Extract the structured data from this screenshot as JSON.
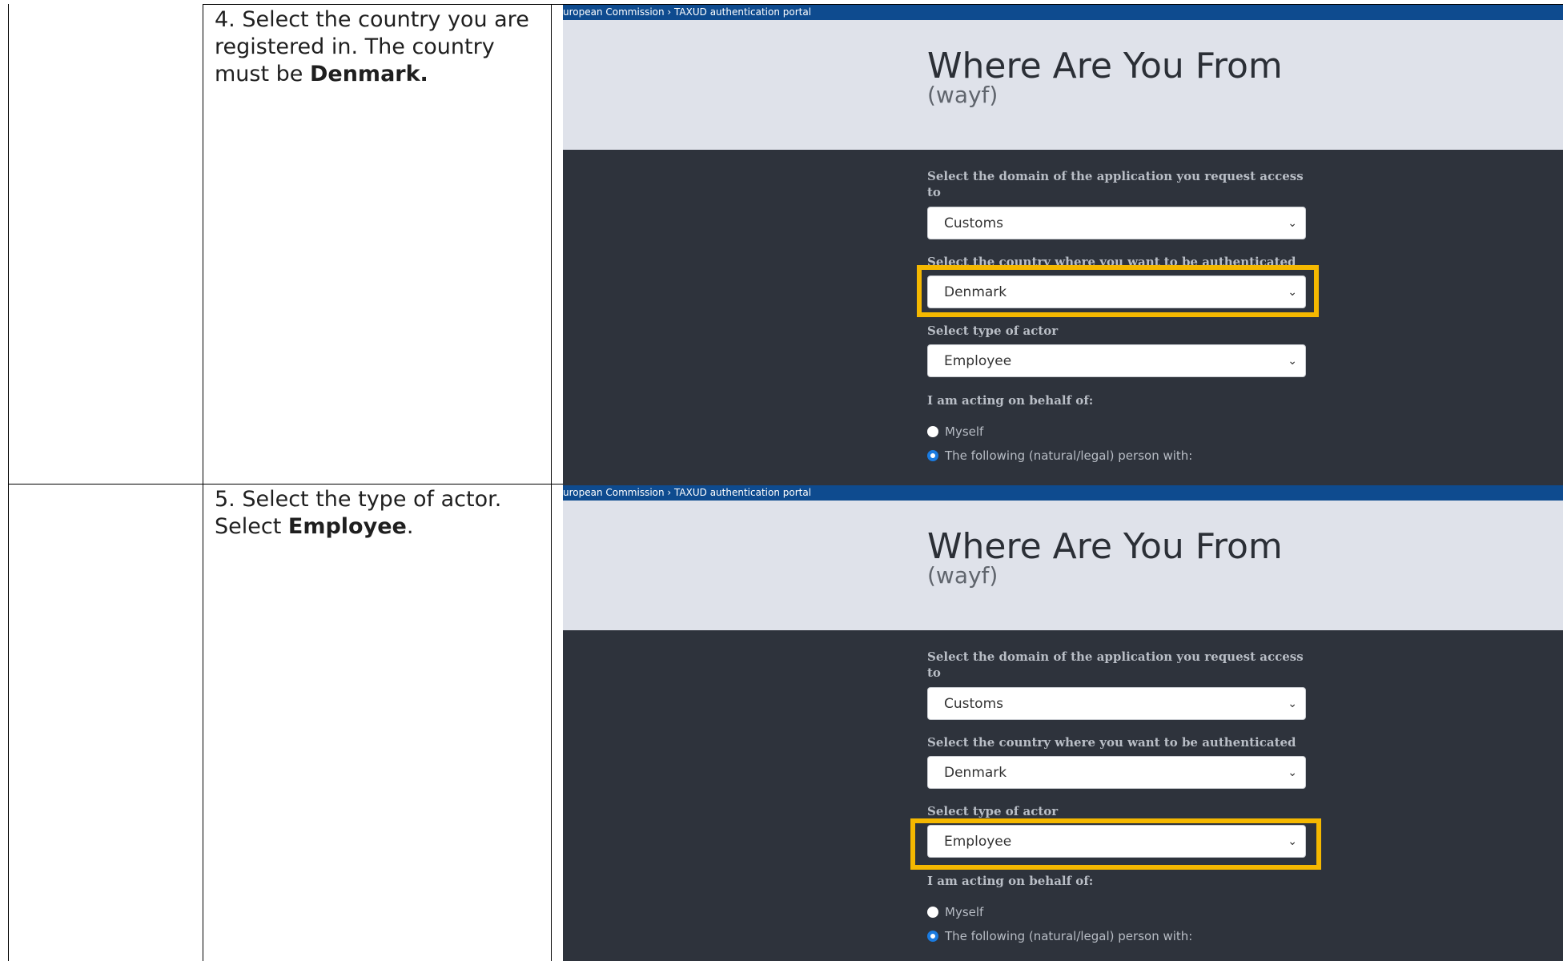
{
  "rows": [
    {
      "instruction": {
        "line1": "4. Select the country you are",
        "line2": "registered in. The country",
        "line3_prefix": "must be ",
        "line3_bold": "Denmark."
      },
      "screenshot": {
        "breadcrumb": "uropean Commission › TAXUD authentication portal",
        "title": "Where Are You From",
        "subtitle": "(wayf)",
        "domain_label": "Select the domain of the application you request access to",
        "domain_value": "Customs",
        "country_label": "Select the country where you want to be authenticated",
        "country_value": "Denmark",
        "actor_label": "Select type of actor",
        "actor_value": "Employee",
        "behalf_label": "I am acting on behalf of:",
        "radio_myself": "Myself",
        "radio_following": "The following (natural/legal) person with:",
        "highlighted_field": "country"
      }
    },
    {
      "instruction": {
        "line1": "5. Select the type of actor.",
        "line2_prefix": "Select ",
        "line2_bold": "Employee",
        "line2_suffix": "."
      },
      "screenshot": {
        "breadcrumb": "uropean Commission › TAXUD authentication portal",
        "title": "Where Are You From",
        "subtitle": "(wayf)",
        "domain_label": "Select the domain of the application you request access to",
        "domain_value": "Customs",
        "country_label": "Select the country where you want to be authenticated",
        "country_value": "Denmark",
        "actor_label": "Select type of actor",
        "actor_value": "Employee",
        "behalf_label": "I am acting on behalf of:",
        "radio_myself": "Myself",
        "radio_following": "The following (natural/legal) person with:",
        "highlighted_field": "actor"
      }
    }
  ],
  "colors": {
    "highlight": "#f5b800",
    "topbar": "#0e4b8f",
    "hero_band": "#dfe2ea",
    "dark_panel": "#2e333c",
    "radio_selected": "#1a7be0"
  },
  "icons": {
    "select_chevron": "chevron-down-icon",
    "radio_unselected": "radio-empty-icon",
    "radio_selected": "radio-filled-icon"
  }
}
